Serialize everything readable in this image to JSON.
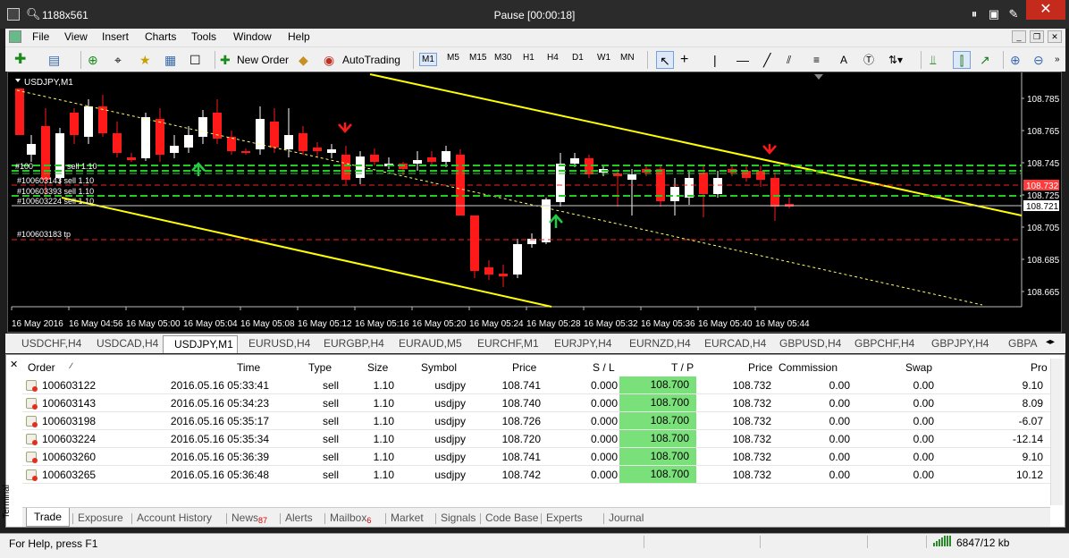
{
  "window": {
    "title": "1188x561",
    "status": "Pause [00:00:18]"
  },
  "menu": [
    "File",
    "View",
    "Insert",
    "Charts",
    "Tools",
    "Window",
    "Help"
  ],
  "toolbar": {
    "new_order": "New Order",
    "autotrading": "AutoTrading",
    "timeframes": [
      "M1",
      "M5",
      "M15",
      "M30",
      "H1",
      "H4",
      "D1",
      "W1",
      "MN"
    ]
  },
  "chart": {
    "symbol_label": "USDJPY,M1",
    "price_labels": [
      "108.785",
      "108.765",
      "108.745",
      "108.725",
      "108.705",
      "108.685",
      "108.665"
    ],
    "price_badges": [
      {
        "label": "108.732",
        "color": "#ff3b3b"
      },
      {
        "label": "108.721",
        "color": "#ffffff"
      }
    ],
    "time_labels": [
      "16 May 2016",
      "16 May 04:56",
      "16 May 05:00",
      "16 May 05:04",
      "16 May 05:08",
      "16 May 05:12",
      "16 May 05:16",
      "16 May 05:20",
      "16 May 05:24",
      "16 May 05:28",
      "16 May 05:32",
      "16 May 05:36",
      "16 May 05:40",
      "16 May 05:44"
    ],
    "order_labels": [
      "#100",
      "sell 1.10",
      "#100603143 sell 1.10",
      "#100603393 sell 1.10",
      "#100603224 sell 1.10",
      "#100603183 tp"
    ]
  },
  "chart_tabs": [
    "USDCHF,H4",
    "USDCAD,H4",
    "USDJPY,M1",
    "EURUSD,H4",
    "EURGBP,H4",
    "EURAUD,M5",
    "EURCHF,M1",
    "EURJPY,H4",
    "EURNZD,H4",
    "EURCAD,H4",
    "GBPUSD,H4",
    "GBPCHF,H4",
    "GBPJPY,H4",
    "GBPA"
  ],
  "active_chart_tab": "USDJPY,M1",
  "terminal": {
    "side_label": "Terminal",
    "headers": [
      "Order",
      "Time",
      "Type",
      "Size",
      "Symbol",
      "Price",
      "S / L",
      "T / P",
      "Price",
      "Commission",
      "Swap",
      "Pro"
    ],
    "rows": [
      {
        "order": "100603122",
        "time": "2016.05.16 05:33:41",
        "type": "sell",
        "size": "1.10",
        "symbol": "usdjpy",
        "price": "108.741",
        "sl": "0.000",
        "tp": "108.700",
        "cur": "108.732",
        "commission": "0.00",
        "swap": "0.00",
        "profit": "9.10"
      },
      {
        "order": "100603143",
        "time": "2016.05.16 05:34:23",
        "type": "sell",
        "size": "1.10",
        "symbol": "usdjpy",
        "price": "108.740",
        "sl": "0.000",
        "tp": "108.700",
        "cur": "108.732",
        "commission": "0.00",
        "swap": "0.00",
        "profit": "8.09"
      },
      {
        "order": "100603198",
        "time": "2016.05.16 05:35:17",
        "type": "sell",
        "size": "1.10",
        "symbol": "usdjpy",
        "price": "108.726",
        "sl": "0.000",
        "tp": "108.700",
        "cur": "108.732",
        "commission": "0.00",
        "swap": "0.00",
        "profit": "-6.07"
      },
      {
        "order": "100603224",
        "time": "2016.05.16 05:35:34",
        "type": "sell",
        "size": "1.10",
        "symbol": "usdjpy",
        "price": "108.720",
        "sl": "0.000",
        "tp": "108.700",
        "cur": "108.732",
        "commission": "0.00",
        "swap": "0.00",
        "profit": "-12.14"
      },
      {
        "order": "100603260",
        "time": "2016.05.16 05:36:39",
        "type": "sell",
        "size": "1.10",
        "symbol": "usdjpy",
        "price": "108.741",
        "sl": "0.000",
        "tp": "108.700",
        "cur": "108.732",
        "commission": "0.00",
        "swap": "0.00",
        "profit": "9.10"
      },
      {
        "order": "100603265",
        "time": "2016.05.16 05:36:48",
        "type": "sell",
        "size": "1.10",
        "symbol": "usdjpy",
        "price": "108.742",
        "sl": "0.000",
        "tp": "108.700",
        "cur": "108.732",
        "commission": "0.00",
        "swap": "0.00",
        "profit": "10.12"
      }
    ],
    "tabs": [
      {
        "label": "Trade"
      },
      {
        "label": "Exposure"
      },
      {
        "label": "Account History"
      },
      {
        "label": "News",
        "badge": "87"
      },
      {
        "label": "Alerts"
      },
      {
        "label": "Mailbox",
        "badge": "6"
      },
      {
        "label": "Market"
      },
      {
        "label": "Signals"
      },
      {
        "label": "Code Base"
      },
      {
        "label": "Experts"
      },
      {
        "label": "Journal"
      }
    ]
  },
  "status": {
    "help": "For Help, press F1",
    "network": "6847/12 kb"
  },
  "colors": {
    "bull": "#ffffff",
    "bear": "#ff1a1a",
    "channel": "#ffff00",
    "sl_line": "#ff2020",
    "tp_line": "#21d121",
    "tp_cell": "#7ae07a"
  }
}
